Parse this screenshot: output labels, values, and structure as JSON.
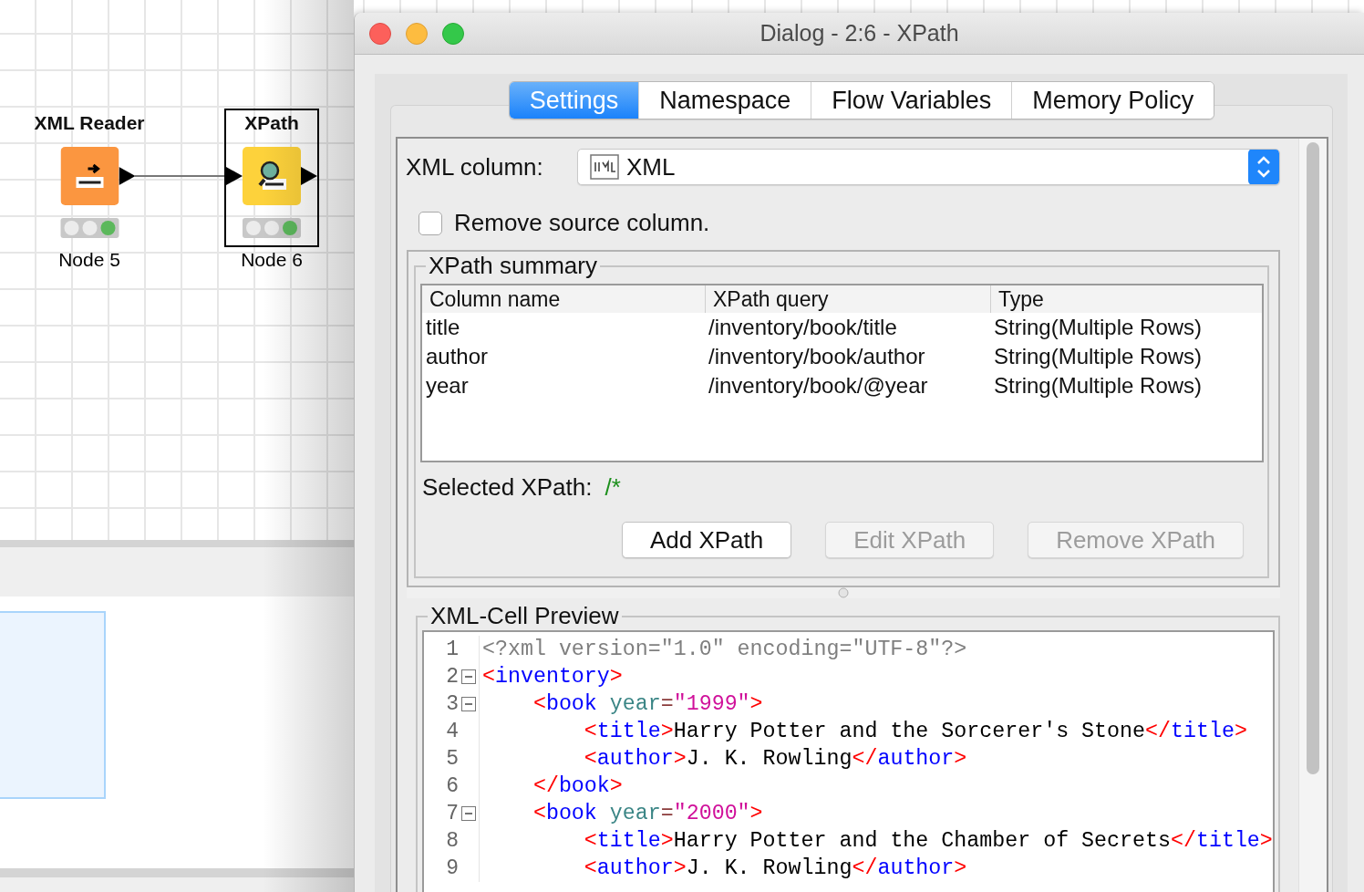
{
  "workflow": {
    "nodes": [
      {
        "title": "XML Reader",
        "label": "Node 5",
        "kind": "reader",
        "selected": false,
        "lights": [
          {
            "color": "#ececec"
          },
          {
            "color": "#ececec"
          },
          {
            "color": "#5cb85c"
          }
        ]
      },
      {
        "title": "XPath",
        "label": "Node 6",
        "kind": "xpath",
        "selected": true,
        "lights": [
          {
            "color": "#ececec"
          },
          {
            "color": "#ececec"
          },
          {
            "color": "#5cb85c"
          }
        ]
      }
    ]
  },
  "dialog": {
    "title": "Dialog - 2:6 - XPath",
    "tabs": [
      {
        "label": "Settings",
        "selected": true
      },
      {
        "label": "Namespace",
        "selected": false
      },
      {
        "label": "Flow Variables",
        "selected": false
      },
      {
        "label": "Memory Policy",
        "selected": false
      }
    ],
    "xml_column": {
      "label": "XML column:",
      "value": "XML"
    },
    "remove_source": {
      "label": "Remove source column.",
      "checked": false
    },
    "summary": {
      "title": "XPath summary",
      "columns": [
        "Column name",
        "XPath query",
        "Type"
      ],
      "rows": [
        [
          "title",
          "/inventory/book/title",
          "String(Multiple Rows)"
        ],
        [
          "author",
          "/inventory/book/author",
          "String(Multiple Rows)"
        ],
        [
          "year",
          "/inventory/book/@year",
          "String(Multiple Rows)"
        ]
      ],
      "selected_label": "Selected XPath:",
      "selected_value": "/*",
      "buttons": [
        {
          "label": "Add XPath",
          "disabled": false
        },
        {
          "label": "Edit XPath",
          "disabled": true
        },
        {
          "label": "Remove XPath",
          "disabled": true
        }
      ]
    },
    "preview": {
      "title": "XML-Cell Preview",
      "lines": [
        {
          "number": "1",
          "fold": false,
          "tokens": [
            {
              "kind": "decl",
              "text": "<?xml version=\"1.0\" encoding=\"UTF-8\"?>"
            }
          ]
        },
        {
          "number": "2",
          "fold": true,
          "tokens": [
            {
              "kind": "bracket",
              "text": "<"
            },
            {
              "kind": "tag",
              "text": "inventory"
            },
            {
              "kind": "bracket",
              "text": ">"
            }
          ]
        },
        {
          "number": "3",
          "fold": true,
          "tokens": [
            {
              "kind": "bracket",
              "text": "    <"
            },
            {
              "kind": "tag",
              "text": "book"
            },
            {
              "kind": "attr",
              "text": " year"
            },
            {
              "kind": "equals",
              "text": "="
            },
            {
              "kind": "value",
              "text": "\"1999\""
            },
            {
              "kind": "bracket",
              "text": ">"
            }
          ]
        },
        {
          "number": "4",
          "fold": false,
          "tokens": [
            {
              "kind": "bracket",
              "text": "        <"
            },
            {
              "kind": "tag",
              "text": "title"
            },
            {
              "kind": "bracket",
              "text": ">"
            },
            {
              "kind": "text",
              "text": "Harry Potter and the Sorcerer's Stone"
            },
            {
              "kind": "bracket",
              "text": "</"
            },
            {
              "kind": "tag",
              "text": "title"
            },
            {
              "kind": "bracket",
              "text": ">"
            }
          ]
        },
        {
          "number": "5",
          "fold": false,
          "tokens": [
            {
              "kind": "bracket",
              "text": "        <"
            },
            {
              "kind": "tag",
              "text": "author"
            },
            {
              "kind": "bracket",
              "text": ">"
            },
            {
              "kind": "text",
              "text": "J. K. Rowling"
            },
            {
              "kind": "bracket",
              "text": "</"
            },
            {
              "kind": "tag",
              "text": "author"
            },
            {
              "kind": "bracket",
              "text": ">"
            }
          ]
        },
        {
          "number": "6",
          "fold": false,
          "tokens": [
            {
              "kind": "bracket",
              "text": "    </"
            },
            {
              "kind": "tag",
              "text": "book"
            },
            {
              "kind": "bracket",
              "text": ">"
            }
          ]
        },
        {
          "number": "7",
          "fold": true,
          "tokens": [
            {
              "kind": "bracket",
              "text": "    <"
            },
            {
              "kind": "tag",
              "text": "book"
            },
            {
              "kind": "attr",
              "text": " year"
            },
            {
              "kind": "equals",
              "text": "="
            },
            {
              "kind": "value",
              "text": "\"2000\""
            },
            {
              "kind": "bracket",
              "text": ">"
            }
          ]
        },
        {
          "number": "8",
          "fold": false,
          "tokens": [
            {
              "kind": "bracket",
              "text": "        <"
            },
            {
              "kind": "tag",
              "text": "title"
            },
            {
              "kind": "bracket",
              "text": ">"
            },
            {
              "kind": "text",
              "text": "Harry Potter and the Chamber of Secrets"
            },
            {
              "kind": "bracket",
              "text": "</"
            },
            {
              "kind": "tag",
              "text": "title"
            },
            {
              "kind": "bracket",
              "text": ">"
            }
          ]
        },
        {
          "number": "9",
          "fold": false,
          "tokens": [
            {
              "kind": "bracket",
              "text": "        <"
            },
            {
              "kind": "tag",
              "text": "author"
            },
            {
              "kind": "bracket",
              "text": ">"
            },
            {
              "kind": "text",
              "text": "J. K. Rowling"
            },
            {
              "kind": "bracket",
              "text": "</"
            },
            {
              "kind": "tag",
              "text": "author"
            },
            {
              "kind": "bracket",
              "text": ">"
            }
          ]
        }
      ]
    }
  }
}
